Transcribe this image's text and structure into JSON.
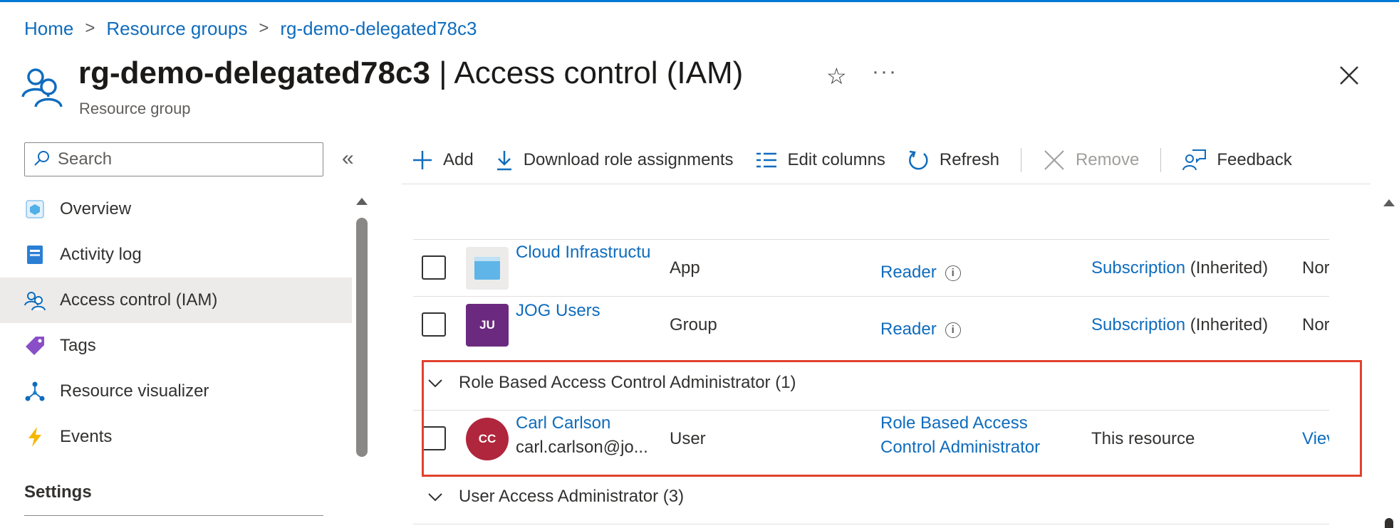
{
  "breadcrumb": {
    "items": [
      "Home",
      "Resource groups",
      "rg-demo-delegated78c3"
    ],
    "separator": ">"
  },
  "header": {
    "resource_name": "rg-demo-delegated78c3",
    "separator": "|",
    "page_name": "Access control (IAM)",
    "subtitle": "Resource group",
    "icon": "users-icon",
    "favorite_icon": "star-icon",
    "more_label": "···"
  },
  "sidebar": {
    "search_placeholder": "Search",
    "collapse_label": "«",
    "items": [
      {
        "label": "Overview",
        "icon": "overview-icon"
      },
      {
        "label": "Activity log",
        "icon": "activity-log-icon"
      },
      {
        "label": "Access control (IAM)",
        "icon": "iam-icon",
        "active": true
      },
      {
        "label": "Tags",
        "icon": "tag-icon"
      },
      {
        "label": "Resource visualizer",
        "icon": "visualizer-icon"
      },
      {
        "label": "Events",
        "icon": "events-icon"
      }
    ],
    "section_settings": "Settings"
  },
  "toolbar": {
    "add": "Add",
    "download": "Download role assignments",
    "edit_columns": "Edit columns",
    "refresh": "Refresh",
    "remove": "Remove",
    "feedback": "Feedback"
  },
  "table": {
    "rows_reader": [
      {
        "name": "Cloud Infrastructu",
        "type": "App",
        "role": "Reader",
        "scope_link": "Subscription",
        "scope_suffix": "(Inherited)",
        "condition": "Nor"
      },
      {
        "name": "JOG Users",
        "initials": "JU",
        "type": "Group",
        "role": "Reader",
        "scope_link": "Subscription",
        "scope_suffix": "(Inherited)",
        "condition": "Nor"
      }
    ],
    "group_rbac": {
      "title": "Role Based Access Control Administrator (1)",
      "row": {
        "name": "Carl Carlson",
        "email": "carl.carlson@jo...",
        "initials": "CC",
        "type": "User",
        "role_line1": "Role Based Access",
        "role_line2": "Control Administrator",
        "scope": "This resource",
        "condition": "Viev"
      }
    },
    "group_uaa": {
      "title": "User Access Administrator (3)"
    }
  },
  "colors": {
    "accent": "#0f6cbd",
    "highlight_border": "#e0422e",
    "avatar_ju": "#6b2a7f",
    "avatar_cc": "#b0263d"
  }
}
